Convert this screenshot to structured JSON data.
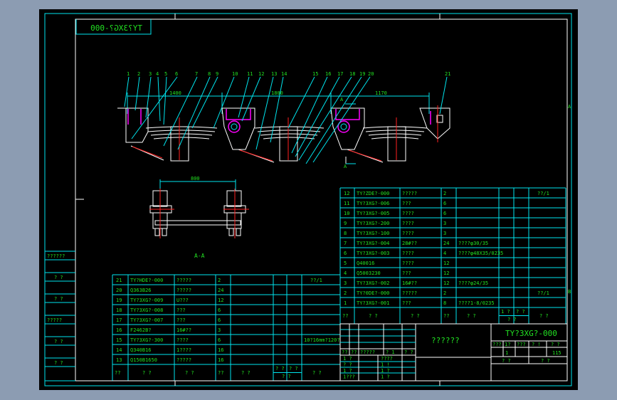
{
  "drawing": {
    "title_mirrored": "TY?3XG?-000",
    "part_labels": [
      "1",
      "2",
      "3",
      "4",
      "5",
      "6",
      "7",
      "8",
      "9",
      "10",
      "11",
      "12",
      "13",
      "14",
      "15",
      "16",
      "17",
      "18",
      "19",
      "20",
      "21"
    ],
    "dimensions": [
      "1400",
      "1800",
      "1170"
    ],
    "section_arrow_label": "A",
    "section_dim": "800",
    "section_title": "A-A",
    "zone_letters": [
      "A",
      "B"
    ]
  },
  "left_strip": [
    "??????",
    "? ?",
    "? ?",
    "?????",
    "? ?",
    "? ?"
  ],
  "bom_right": {
    "rows": [
      [
        "12",
        "TY?ZDE?-000",
        "?????",
        "2",
        "",
        "",
        "",
        "??/1"
      ],
      [
        "11",
        "TY?3XG?-006",
        "???",
        "6",
        "",
        "",
        "",
        ""
      ],
      [
        "10",
        "TY?3XG?-005",
        "????",
        "6",
        "",
        "",
        "",
        ""
      ],
      [
        "9",
        "TY?3XG?-200",
        "????",
        "3",
        "",
        "",
        "",
        ""
      ],
      [
        "8",
        "TY?3XG?-100",
        "????",
        "3",
        "",
        "",
        "",
        ""
      ],
      [
        "7",
        "TY?3XG?-004",
        "28#??",
        "24",
        "????φ30/35",
        "",
        "",
        ""
      ],
      [
        "6",
        "TY?3XG?-003",
        "????",
        "4",
        "????φ48X35/0235",
        "",
        "",
        ""
      ],
      [
        "5",
        "Q40016",
        "????",
        "12",
        "",
        "",
        "",
        ""
      ],
      [
        "4",
        "Q5003230",
        "???",
        "12",
        "",
        "",
        "",
        ""
      ],
      [
        "3",
        "TY?3XG?-002",
        "16#??",
        "12",
        "????φ24/35",
        "",
        "",
        ""
      ],
      [
        "2",
        "TY?0DE?-000",
        "?????",
        "2",
        "",
        "",
        "",
        "??/1"
      ],
      [
        "1",
        "TY?3XG?-001",
        "???",
        "8",
        "????1-8/0235",
        "",
        "",
        ""
      ]
    ],
    "header": [
      "??",
      "? ?",
      "? ?",
      "??",
      "? ?",
      "1 ?",
      "? ?",
      "? ?",
      "? ?"
    ]
  },
  "bom_left": {
    "rows": [
      [
        "21",
        "TY?HDE?-000",
        "?????",
        "2",
        "",
        "",
        "",
        "??/1"
      ],
      [
        "20",
        "Q363B26",
        "?????",
        "24",
        "",
        "",
        "",
        ""
      ],
      [
        "19",
        "TY?3XG?-009",
        "U???",
        "12",
        "",
        "",
        "",
        ""
      ],
      [
        "18",
        "TY?3XG?-008",
        "???",
        "6",
        "",
        "",
        "",
        ""
      ],
      [
        "17",
        "TY?3XG?-007",
        "???",
        "6",
        "",
        "",
        "",
        ""
      ],
      [
        "16",
        "F2462B?",
        "16#??",
        "3",
        "",
        "",
        "",
        ""
      ],
      [
        "15",
        "TY?3XG?-300",
        "????",
        "6",
        "",
        "",
        "",
        "10?16mm?120?"
      ],
      [
        "14",
        "Q340B16",
        "1????",
        "16",
        "",
        "",
        "",
        ""
      ],
      [
        "13",
        "Q150B1650",
        "?????",
        "16",
        "",
        "",
        "",
        ""
      ]
    ],
    "header": [
      "??",
      "? ?",
      "? ?",
      "??",
      "? ?",
      "? ?",
      "? ?",
      "? ?",
      "? ?"
    ]
  },
  "title_block": {
    "name": "??????",
    "drawing_no": "TY?3XG?-000",
    "stage_headers": [
      "???",
      "1?",
      "???",
      "? !",
      "? ?"
    ],
    "quantity": "1",
    "scale": "115",
    "sheet_labels": [
      "? ?",
      "? ?"
    ],
    "rev_header": [
      "??",
      "??",
      "?????",
      "? 1",
      "? ?"
    ],
    "sign_rows": [
      [
        "1 ?",
        "????"
      ],
      [
        "? ?",
        "1 !"
      ],
      [
        "1 ?",
        "1 ?"
      ],
      [
        "1???",
        "1 ?"
      ]
    ]
  },
  "colors": {
    "background": "#000000",
    "frame": "#00e5ee",
    "text": "#22e022",
    "outline": "#ffffff",
    "accent": "#ff00ff",
    "centerline": "#ff2020"
  }
}
